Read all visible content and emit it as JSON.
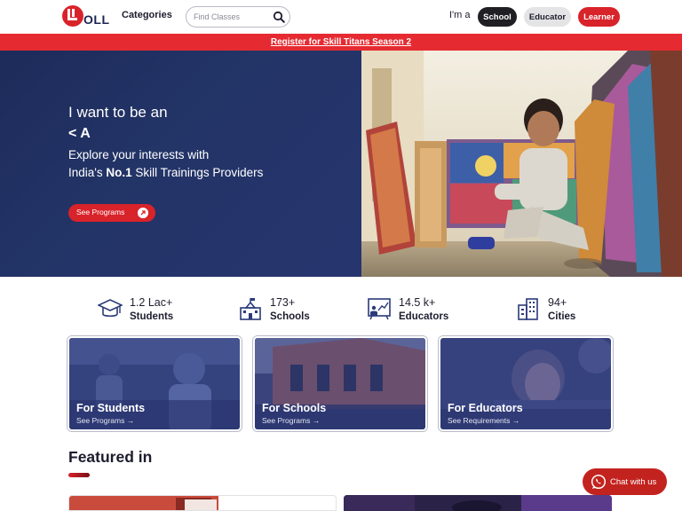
{
  "header": {
    "logo_text": "OLL",
    "categories_label": "Categories",
    "search_placeholder": "Find Classes",
    "role_prompt": "I'm a",
    "roles": [
      "School",
      "Educator",
      "Learner"
    ]
  },
  "banner": {
    "text": "Register for Skill Titans Season 2"
  },
  "hero": {
    "line1": "I want to be an",
    "line2": "< A",
    "line3": "Explore your interests with",
    "line4_prefix": "India's ",
    "line4_bold": "No.1",
    "line4_suffix": " Skill Trainings Providers",
    "cta_label": "See Programs"
  },
  "stats": [
    {
      "value": "1.2 Lac+",
      "label": "Students",
      "icon": "graduation-cap-icon"
    },
    {
      "value": "173+",
      "label": "Schools",
      "icon": "school-building-icon"
    },
    {
      "value": "14.5 k+",
      "label": "Educators",
      "icon": "whiteboard-teacher-icon"
    },
    {
      "value": "94+",
      "label": "Cities",
      "icon": "city-buildings-icon"
    }
  ],
  "cards": [
    {
      "title": "For Students",
      "link": "See Programs →"
    },
    {
      "title": "For Schools",
      "link": "See Programs →"
    },
    {
      "title": "For Educators",
      "link": "See Requirements →"
    }
  ],
  "featured": {
    "title": "Featured in"
  },
  "chat": {
    "label": "Chat with us"
  },
  "colors": {
    "brand_red": "#d8232a",
    "hero_navy": "#233467",
    "text_dark": "#1c1c2e"
  }
}
